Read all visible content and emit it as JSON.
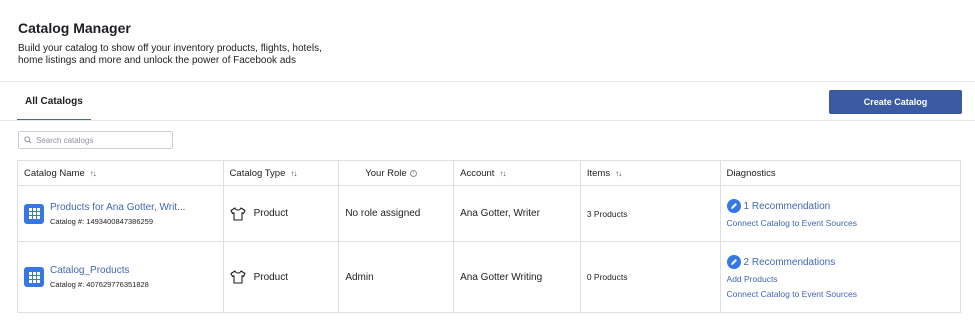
{
  "header": {
    "title": "Catalog Manager",
    "description": "Build your catalog to show off your inventory products, flights, hotels, home listings and more and unlock the power of Facebook ads"
  },
  "tabs": [
    {
      "label": "All Catalogs",
      "active": true
    }
  ],
  "create_button": {
    "label": "Create Catalog"
  },
  "search": {
    "placeholder": "Search catalogs"
  },
  "colors": {
    "accent": "#4267b2",
    "button": "#3b5aa3",
    "icon_blue": "#3578e5"
  },
  "table": {
    "columns": [
      {
        "label": "Catalog Name",
        "sortable": true
      },
      {
        "label": "Catalog Type",
        "sortable": true
      },
      {
        "label": "Your Role",
        "info": true
      },
      {
        "label": "Account",
        "sortable": true
      },
      {
        "label": "Items",
        "sortable": true
      },
      {
        "label": "Diagnostics"
      }
    ],
    "rows": [
      {
        "name": "Products for Ana Gotter, Writ...",
        "catalog_number": "Catalog #: 1493400847386259",
        "type": "Product",
        "role": "No role assigned",
        "account": "Ana Gotter, Writer",
        "items": "3 Products",
        "diagnostics": {
          "recommendation": "1 Recommendation",
          "links": [
            "Connect Catalog to Event Sources"
          ]
        }
      },
      {
        "name": "Catalog_Products",
        "catalog_number": "Catalog #: 407629776351828",
        "type": "Product",
        "role": "Admin",
        "account": "Ana Gotter Writing",
        "items": "0 Products",
        "diagnostics": {
          "recommendation": "2 Recommendations",
          "links": [
            "Add Products",
            "Connect Catalog to Event Sources"
          ]
        }
      }
    ]
  }
}
